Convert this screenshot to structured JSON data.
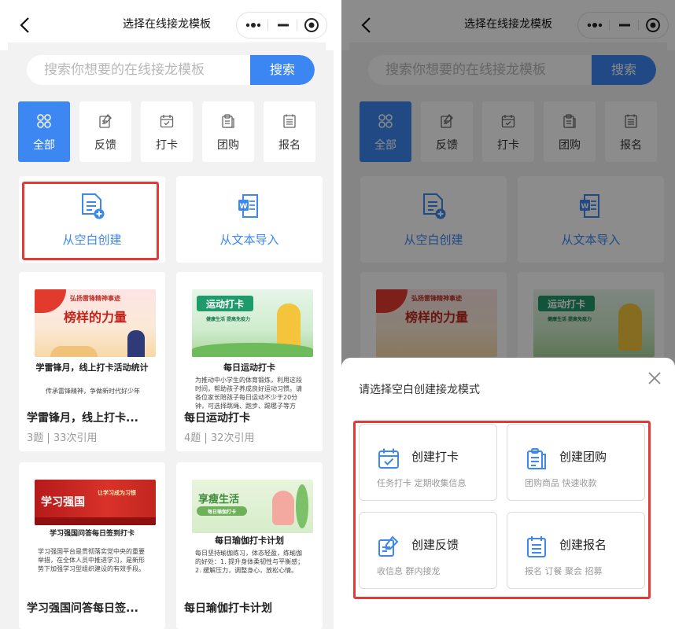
{
  "nav": {
    "title": "选择在线接龙模板"
  },
  "search": {
    "placeholder": "搜索你想要的在线接龙模板",
    "button": "搜索"
  },
  "categories": [
    {
      "label": "全部",
      "icon": "grid-icon"
    },
    {
      "label": "反馈",
      "icon": "edit-doc-icon"
    },
    {
      "label": "打卡",
      "icon": "calendar-check-icon"
    },
    {
      "label": "团购",
      "icon": "clipboard-icon"
    },
    {
      "label": "报名",
      "icon": "list-icon"
    }
  ],
  "create": {
    "blank": "从空白创建",
    "import": "从文本导入"
  },
  "templates": [
    {
      "banner_text": "弘扬雷锋精神事迹",
      "banner_title": "榜样的力量",
      "thumb_title": "学雷锋月，线上打卡活动统计",
      "thumb_body": "传承雷锋精神，争做新时代好少年",
      "name": "学雷锋月，线上打卡...",
      "meta": "3题 | 33次引用"
    },
    {
      "banner_text": "运动打卡",
      "banner_sub": "健康生活 提高免疫力",
      "thumb_title": "每日运动打卡",
      "thumb_body": "为推动中小学生的体育锻炼，利用这段时间，帮助孩子养成良好运动习惯。请各位家长陪孩子每日运动不少于20分钟，可选择跳绳、跑步、踢毽子等方式，并在下方完成运动打卡。",
      "name": "每日运动打卡",
      "meta": "4题 | 32次引用"
    },
    {
      "banner_text": "学习强国",
      "banner_sub": "让学习成为习惯",
      "thumb_title": "学习强国问答每日签到打卡",
      "thumb_body": "学习强国平台是贯彻落实党中央的重要举措，在全体人员中推进学习，是新形势下加强学习型组织建设的有效手段。",
      "name": "学习强国问答每日签...",
      "meta": ""
    },
    {
      "banner_text": "享瘦生活",
      "banner_sub": "每日瑜伽打卡",
      "thumb_title": "每日瑜伽打卡计划",
      "thumb_body": "每日坚持瑜伽练习，体态轻盈，练瑜伽的好处：1. 提升身体柔韧性与平衡感；2. 缓解压力，调整身心，放松心情。",
      "name": "每日瑜伽打卡计划",
      "meta": ""
    }
  ],
  "sheet": {
    "title": "请选择空白创建接龙模式",
    "modes": [
      {
        "title": "创建打卡",
        "desc": "任务打卡 定期收集信息",
        "icon": "calendar-check-icon"
      },
      {
        "title": "创建团购",
        "desc": "团购商品 快速收款",
        "icon": "clipboard-icon"
      },
      {
        "title": "创建反馈",
        "desc": "收信息 群内接龙",
        "icon": "edit-doc-icon"
      },
      {
        "title": "创建报名",
        "desc": "报名 订餐 聚会 招募",
        "icon": "list-icon"
      }
    ]
  },
  "colors": {
    "accent": "#3d87f2",
    "highlight": "#e53935",
    "overlay": "rgba(0,0,0,0.45)"
  }
}
